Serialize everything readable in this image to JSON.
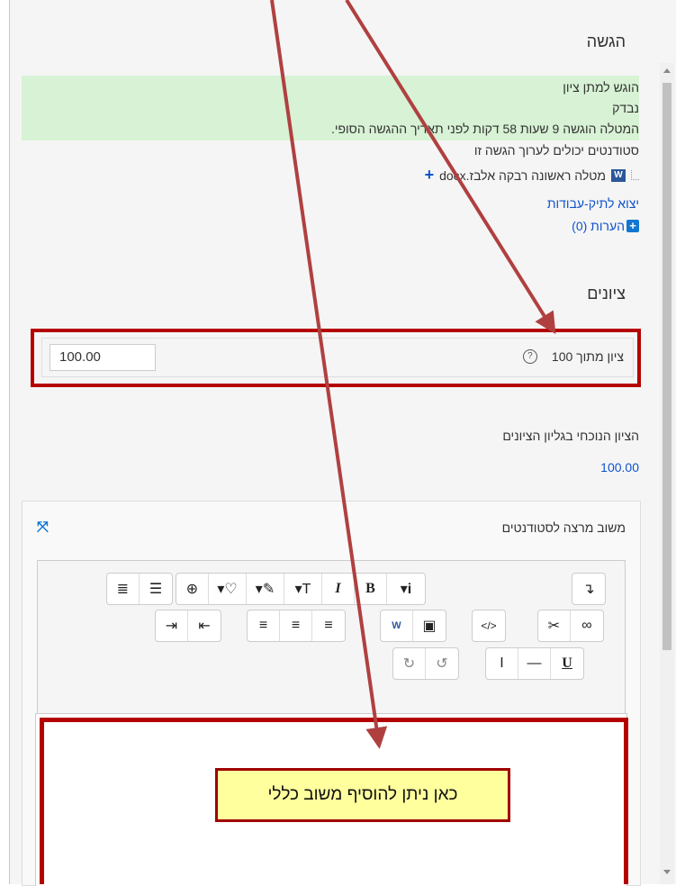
{
  "section": {
    "title": "הגשה"
  },
  "status": {
    "line1": "הוגש למתן ציון",
    "line2": "נבדק",
    "line3": "המטלה הוגשה 9 שעות 58 דקות לפני תאריך ההגשה הסופי.",
    "line4": "סטודנטים יכולים לערוך הגשה זו"
  },
  "file": {
    "name": "מטלה ראשונה רבקה אלבז.docx",
    "icon": "word-file-icon"
  },
  "portfolio_link": "יצוא לתיק-עבודות",
  "comments_link": "הערות (0)",
  "grades": {
    "heading": "ציונים",
    "label": "ציון מתוך 100",
    "value": "100.00",
    "current_label": "הציון הנוכחי בגליון הציונים",
    "current_value": "100.00"
  },
  "feedback": {
    "title": "משוב מרצה לסטודנטים"
  },
  "callout": {
    "text": "כאן ניתן להוסיף משוב כללי"
  },
  "colors": {
    "highlight": "#b40000",
    "status_bg": "#d7f2d4",
    "link": "#0f52ce",
    "callout_bg": "#ffff9e"
  }
}
